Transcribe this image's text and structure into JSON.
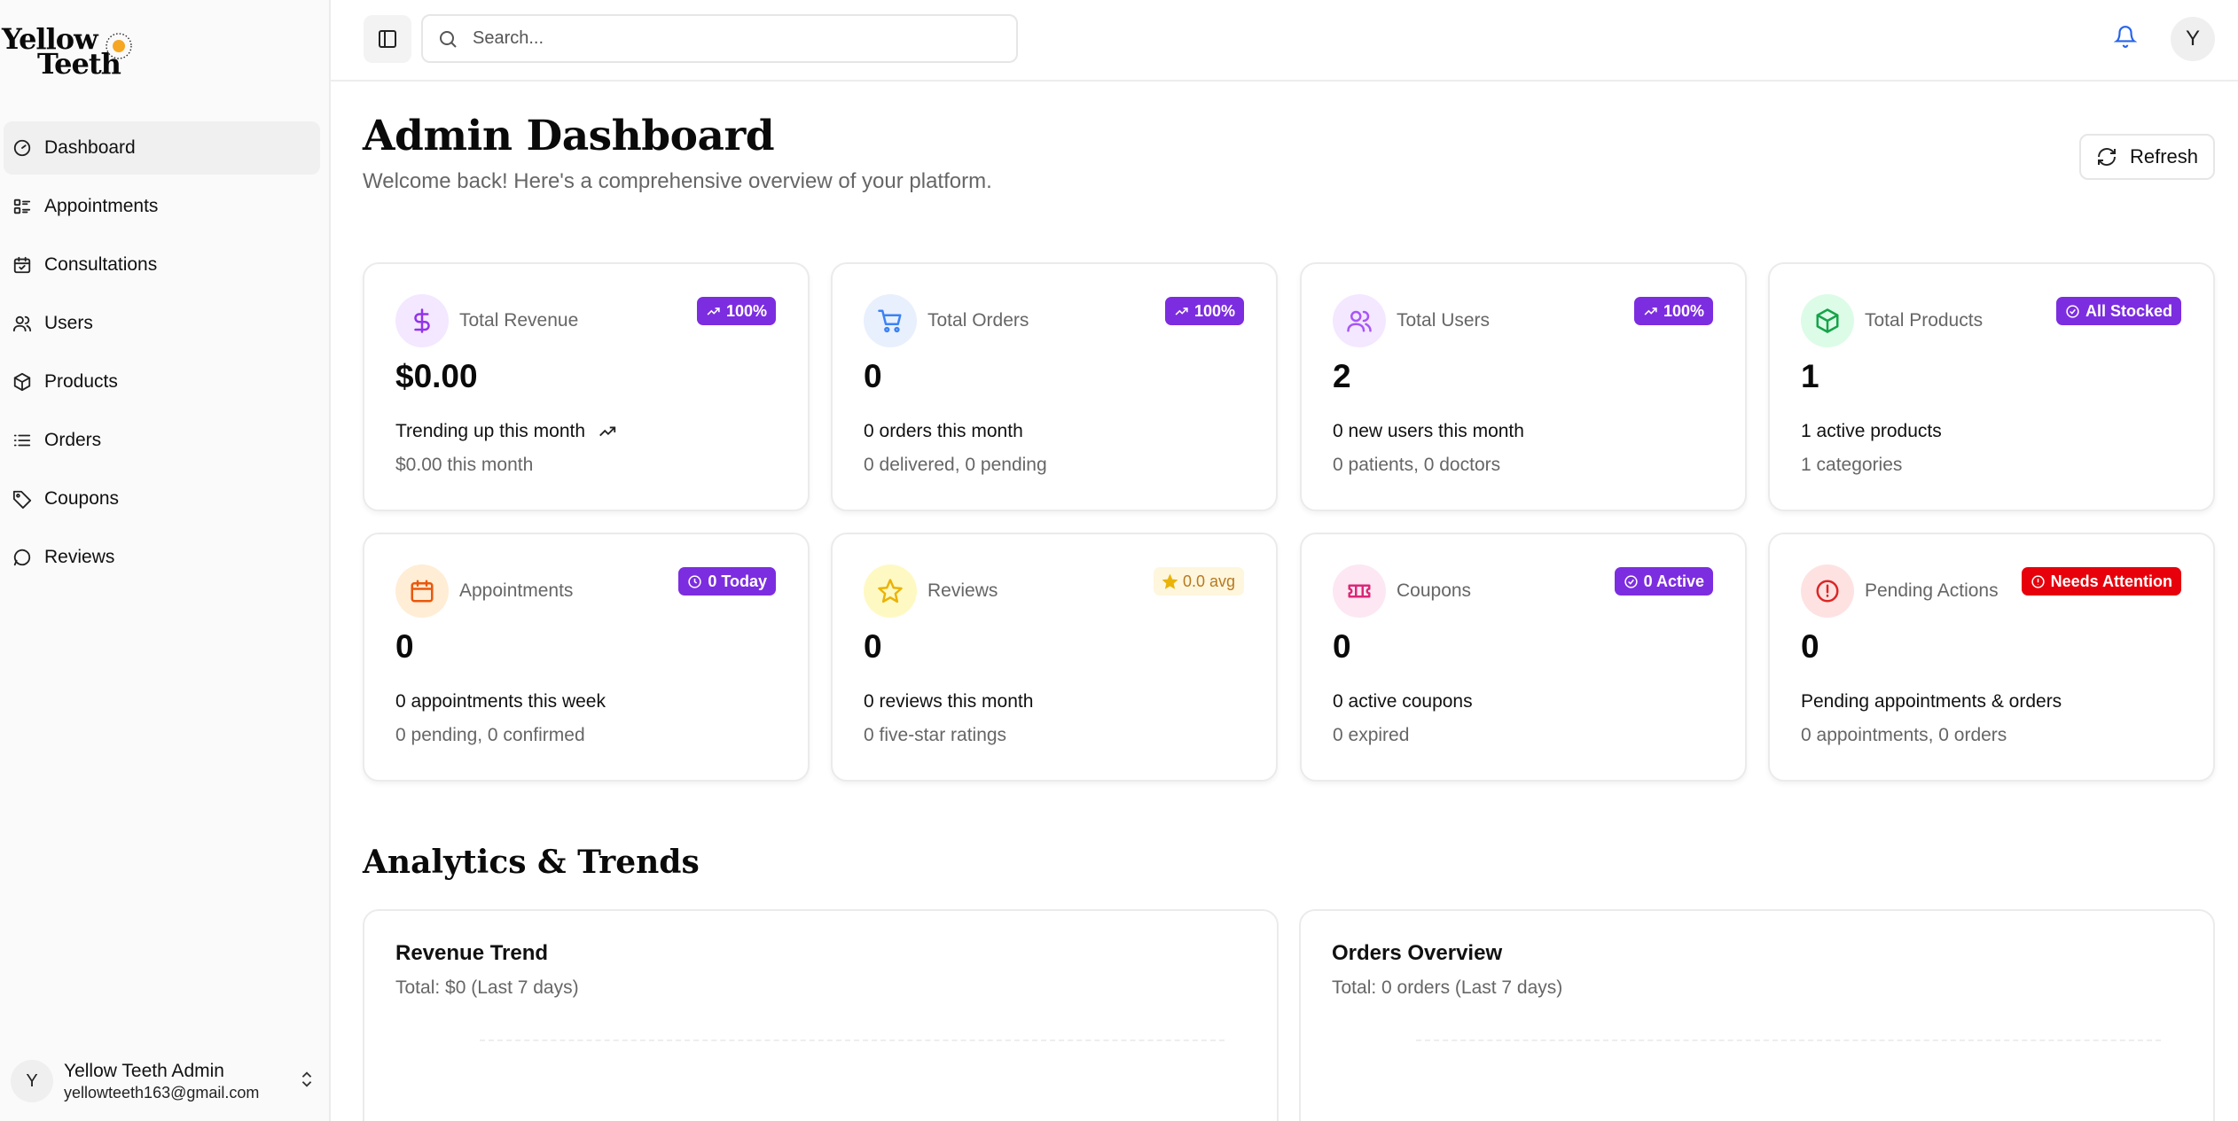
{
  "brand": {
    "line1": "Yellow",
    "line2": "Teeth",
    "accent": "#f5a623"
  },
  "sidebar": {
    "items": [
      {
        "label": "Dashboard",
        "icon": "gauge-icon",
        "active": true
      },
      {
        "label": "Appointments",
        "icon": "list-checks-icon"
      },
      {
        "label": "Consultations",
        "icon": "calendar-icon"
      },
      {
        "label": "Users",
        "icon": "users-icon"
      },
      {
        "label": "Products",
        "icon": "package-icon"
      },
      {
        "label": "Orders",
        "icon": "list-icon"
      },
      {
        "label": "Coupons",
        "icon": "tag-icon"
      },
      {
        "label": "Reviews",
        "icon": "message-circle-icon"
      }
    ],
    "user": {
      "initial": "Y",
      "name": "Yellow Teeth Admin",
      "email": "yellowteeth163@gmail.com"
    }
  },
  "topbar": {
    "search_placeholder": "Search...",
    "avatar_initial": "Y"
  },
  "header": {
    "title": "Admin Dashboard",
    "subtitle": "Welcome back! Here's a comprehensive overview of your platform.",
    "refresh_label": "Refresh"
  },
  "cards": [
    {
      "label": "Total Revenue",
      "badge": "100%",
      "badge_icon": "trending-up-icon",
      "value": "$0.00",
      "line1": "Trending up this month",
      "line2": "$0.00 this month",
      "icon": "dollar-icon",
      "icon_color": "#9333ea",
      "icon_bg": "#f3e8ff",
      "badge_bg": "#7c2de0"
    },
    {
      "label": "Total Orders",
      "badge": "100%",
      "badge_icon": "trending-up-icon",
      "value": "0",
      "line1": "0 orders this month",
      "line2": "0 delivered, 0 pending",
      "icon": "cart-icon",
      "icon_color": "#3b82f6",
      "icon_bg": "#e8f0fe",
      "badge_bg": "#7c2de0"
    },
    {
      "label": "Total Users",
      "badge": "100%",
      "badge_icon": "trending-up-icon",
      "value": "2",
      "line1": "0 new users this month",
      "line2": "0 patients, 0 doctors",
      "icon": "users-icon",
      "icon_color": "#a855f7",
      "icon_bg": "#f3e8ff",
      "badge_bg": "#7c2de0"
    },
    {
      "label": "Total Products",
      "badge": "All Stocked",
      "badge_icon": "check-circle-icon",
      "value": "1",
      "line1": "1 active products",
      "line2": "1 categories",
      "icon": "package-icon",
      "icon_color": "#16a34a",
      "icon_bg": "#dcfce7",
      "badge_bg": "#7c2de0"
    },
    {
      "label": "Appointments",
      "badge": "0 Today",
      "badge_icon": "clock-icon",
      "value": "0",
      "line1": "0 appointments this week",
      "line2": "0 pending, 0 confirmed",
      "icon": "calendar-icon",
      "icon_color": "#ea580c",
      "icon_bg": "#ffedd5",
      "badge_bg": "#7c2de0"
    },
    {
      "label": "Reviews",
      "badge": "0.0 avg",
      "badge_icon": "star-icon",
      "value": "0",
      "line1": "0 reviews this month",
      "line2": "0 five-star ratings",
      "icon": "star-icon",
      "icon_color": "#eab308",
      "icon_bg": "#fef9c3",
      "badge_bg": "#fef6dd"
    },
    {
      "label": "Coupons",
      "badge": "0 Active",
      "badge_icon": "check-circle-icon",
      "value": "0",
      "line1": "0 active coupons",
      "line2": "0 expired",
      "icon": "ticket-icon",
      "icon_color": "#db2777",
      "icon_bg": "#fce7f3",
      "badge_bg": "#7c2de0"
    },
    {
      "label": "Pending Actions",
      "badge": "Needs Attention",
      "badge_icon": "alert-circle-icon",
      "value": "0",
      "line1": "Pending appointments & orders",
      "line2": "0 appointments, 0 orders",
      "icon": "alert-circle-icon",
      "icon_color": "#dc2626",
      "icon_bg": "#fee2e2",
      "badge_bg": "#e7000b"
    }
  ],
  "analytics": {
    "title": "Analytics & Trends",
    "panels": [
      {
        "title": "Revenue Trend",
        "subtitle": "Total: $0 (Last 7 days)"
      },
      {
        "title": "Orders Overview",
        "subtitle": "Total: 0 orders (Last 7 days)"
      }
    ]
  }
}
